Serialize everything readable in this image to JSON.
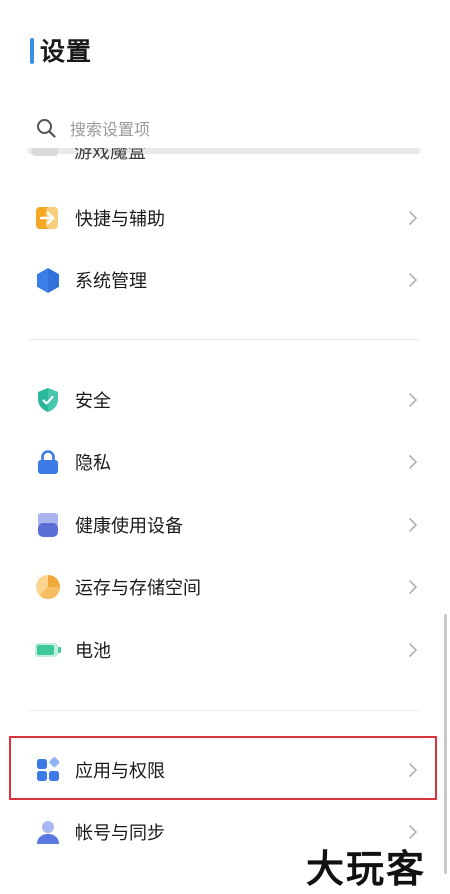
{
  "page": {
    "title": "设置"
  },
  "search": {
    "placeholder": "搜索设置项",
    "value": "",
    "icon": "search-icon"
  },
  "scrolled_row": {
    "label": "游戏魔盒"
  },
  "groups": [
    {
      "items": [
        {
          "label": "快捷与辅助",
          "icon": "arrow-right-box-icon",
          "color": "#f5a623"
        },
        {
          "label": "系统管理",
          "icon": "hexagon-icon",
          "color": "#3a7ee8"
        }
      ]
    },
    {
      "items": [
        {
          "label": "安全",
          "icon": "shield-icon",
          "color": "#2bb79a"
        },
        {
          "label": "隐私",
          "icon": "lock-icon",
          "color": "#3c7be6"
        },
        {
          "label": "健康使用设备",
          "icon": "person-card-icon",
          "color": "#5a6fd6"
        },
        {
          "label": "运存与存储空间",
          "icon": "pie-chart-icon",
          "color": "#f2a93b"
        },
        {
          "label": "电池",
          "icon": "battery-icon",
          "color": "#3ec99a"
        }
      ]
    },
    {
      "items": [
        {
          "label": "应用与权限",
          "icon": "apps-grid-icon",
          "color": "#3c7be6"
        },
        {
          "label": "帐号与同步",
          "icon": "user-icon",
          "color": "#5b77e0"
        }
      ]
    }
  ],
  "highlight": {
    "color": "#d9343b"
  },
  "watermark": {
    "text": "大玩客"
  }
}
